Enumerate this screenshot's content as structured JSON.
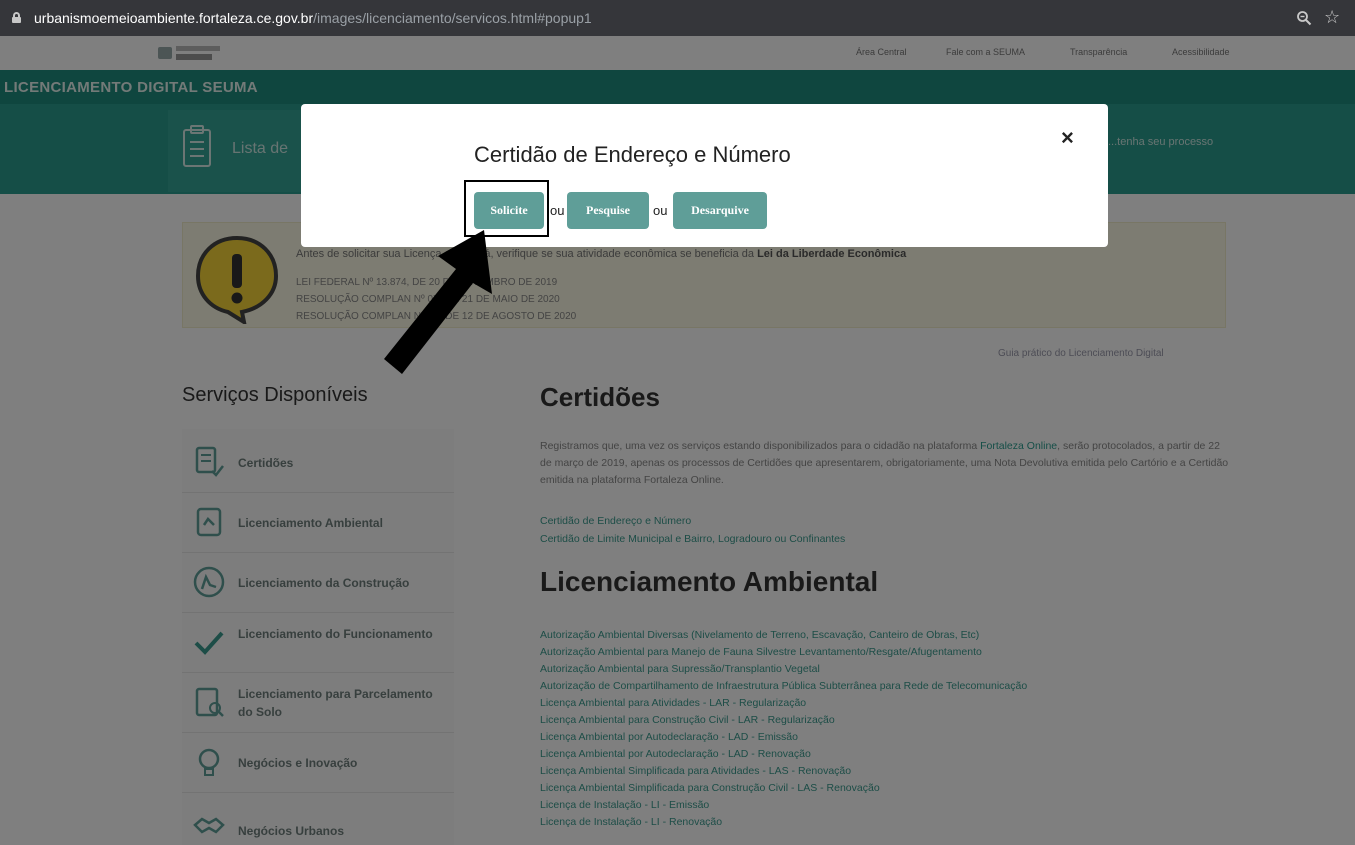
{
  "browser": {
    "url_host": "urbanismoemeioambiente.fortaleza.ce.gov.br",
    "url_path": "/images/licenciamento/servicos.html#popup1",
    "icons": [
      "lock-icon",
      "zoom-icon",
      "star-icon"
    ]
  },
  "header": {
    "nav": [
      "Área Central",
      "Fale com a SEUMA",
      "Transparência",
      "Acessibilidade"
    ],
    "brand": "LICENCIAMENTO DIGITAL SEUMA",
    "tab_label": "Lista de",
    "tab_right": "...tenha seu processo"
  },
  "warning": {
    "line1_prefix": "Antes de solicitar sua Licença ou Alvará, verifique se sua atividade econômica se beneficia da",
    "line1_bold": "Lei da Liberdade Econômica",
    "laws": [
      "LEI FEDERAL Nº 13.874, DE 20 DE SETEMBRO DE 2019",
      "RESOLUÇÃO COMPLAN Nº 0X, DE 21 DE MAIO DE 2020",
      "RESOLUÇÃO COMPLAN Nº 0X, DE 12 DE AGOSTO DE 2020"
    ]
  },
  "guide_link": "Guia prático do Licenciamento Digital",
  "sidebar": {
    "title": "Serviços Disponíveis",
    "items": [
      {
        "label": "Certidões",
        "icon": "certificate-icon"
      },
      {
        "label": "Licenciamento Ambiental",
        "icon": "document-icon"
      },
      {
        "label": "Licenciamento da Construção",
        "icon": "construction-icon"
      },
      {
        "label": "Licenciamento do Funcionamento",
        "icon": "check-icon"
      },
      {
        "label": "Licenciamento para Parcelamento do Solo",
        "icon": "clipboard-search-icon"
      },
      {
        "label": "Negócios e Inovação",
        "icon": "lightbulb-icon"
      },
      {
        "label": "Negócios Urbanos",
        "icon": "handshake-icon"
      }
    ]
  },
  "main": {
    "certidoes_title": "Certidões",
    "paragraph_a": "Registramos que, uma vez os serviços estando disponibilizados para o cidadão na plataforma",
    "paragraph_link": "Fortaleza Online",
    "paragraph_b": ", serão protocolados, a partir de 22 de março de 2019, apenas os processos de Certidões que apresentarem, obrigatoriamente, uma Nota Devolutiva emitida pelo Cartório e a Certidão emitida na plataforma Fortaleza Online.",
    "cert_links": [
      "Certidão de Endereço e Número",
      "Certidão de Limite Municipal e Bairro, Logradouro ou Confinantes"
    ],
    "ambiental_title": "Licenciamento Ambiental",
    "ambiental_links": [
      "Autorização Ambiental Diversas (Nivelamento de Terreno, Escavação, Canteiro de Obras, Etc)",
      "Autorização Ambiental para Manejo de Fauna Silvestre Levantamento/Resgate/Afugentamento",
      "Autorização Ambiental para Supressão/Transplantio Vegetal",
      "Autorização de Compartilhamento de Infraestrutura Pública Subterrânea para Rede de Telecomunicação",
      "Licença Ambiental para Atividades - LAR - Regularização",
      "Licença Ambiental para Construção Civil - LAR - Regularização",
      "Licença Ambiental por Autodeclaração - LAD - Emissão",
      "Licença Ambiental por Autodeclaração - LAD - Renovação",
      "Licença Ambiental Simplificada para Atividades - LAS - Renovação",
      "Licença Ambiental Simplificada para Construção Civil - LAS - Renovação",
      "Licença de Instalação - LI - Emissão",
      "Licença de Instalação - LI - Renovação"
    ]
  },
  "modal": {
    "title": "Certidão de Endereço e Número",
    "close": "×",
    "buttons": [
      "Solicite",
      "Pesquise",
      "Desarquive"
    ],
    "separator": "ou"
  },
  "annotation": {
    "target": "Solicite",
    "highlight_color": "#000000",
    "arrow_color": "#000000"
  },
  "colors": {
    "brand_green": "#1e8d7e",
    "button_teal": "#5f9e98",
    "browser_bar": "#35363a"
  }
}
